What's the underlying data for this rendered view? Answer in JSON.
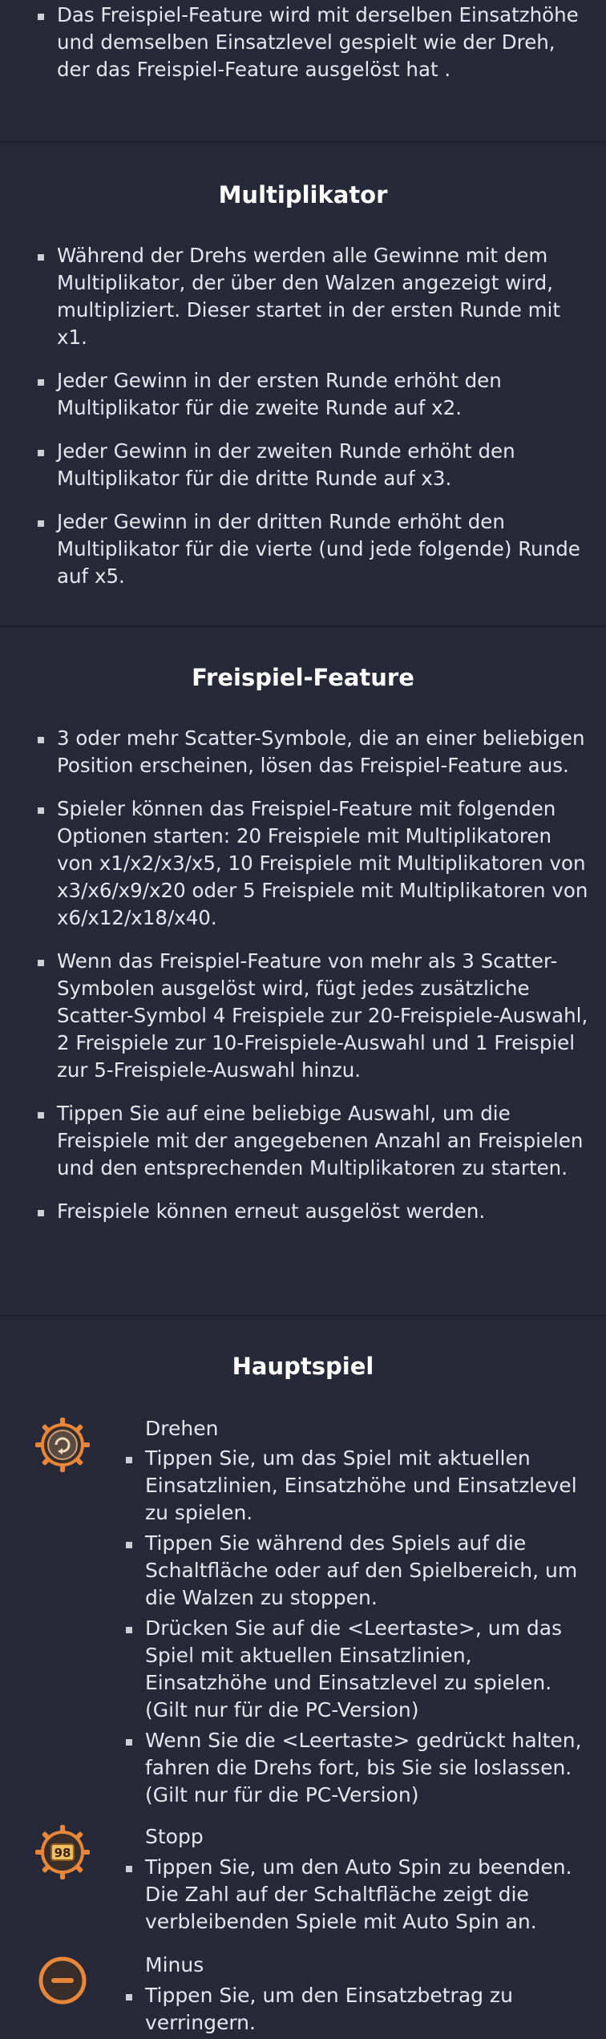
{
  "top_section": {
    "items": [
      "Das Freispiel-Feature wird mit derselben Einsatzhöhe und demselben Einsatzlevel gespielt wie der Dreh, der das Freispiel-Feature ausgelöst hat ."
    ]
  },
  "multiplikator": {
    "title": "Multiplikator",
    "items": [
      "Während der Drehs werden alle Gewinne mit dem Multiplikator, der über den Walzen angezeigt wird, multipliziert. Dieser startet in der ersten Runde mit x1.",
      "Jeder Gewinn in der ersten Runde erhöht den Multiplikator für die zweite Runde auf x2.",
      "Jeder Gewinn in der zweiten Runde erhöht den Multiplikator für die dritte Runde auf x3.",
      "Jeder Gewinn in der dritten Runde erhöht den Multiplikator für die vierte (und jede folgende) Runde auf x5."
    ]
  },
  "freispiel": {
    "title": "Freispiel-Feature",
    "items": [
      "3 oder mehr Scatter-Symbole, die an einer beliebigen Position erscheinen, lösen das Freispiel-Feature aus.",
      "Spieler können das Freispiel-Feature mit folgenden Optionen starten: 20 Freispiele mit Multiplikatoren von x1/x2/x3/x5, 10 Freispiele mit Multiplikatoren von x3/x6/x9/x20 oder 5 Freispiele mit Multiplikatoren von x6/x12/x18/x40.",
      "Wenn das Freispiel-Feature von mehr als 3 Scatter-Symbolen ausgelöst wird, fügt jedes zusätzliche Scatter-Symbol 4 Freispiele zur 20-Freispiele-Auswahl, 2 Freispiele zur 10-Freispiele-Auswahl und 1 Freispiel zur 5-Freispiele-Auswahl hinzu.",
      "Tippen Sie auf eine beliebige Auswahl, um die Freispiele mit der angegebenen Anzahl an Freispielen und den entsprechenden Multiplikatoren zu starten.",
      "Freispiele können erneut ausgelöst werden."
    ]
  },
  "hauptspiel": {
    "title": "Hauptspiel",
    "entries": [
      {
        "icon": "spin-icon",
        "title": "Drehen",
        "items": [
          "Tippen Sie, um das Spiel mit aktuellen Einsatzlinien, Einsatzhöhe und Einsatzlevel zu spielen.",
          "Tippen Sie während des Spiels auf die Schaltfläche oder auf den Spielbereich, um die Walzen zu stoppen.",
          "Drücken Sie auf die <Leertaste>, um das Spiel mit aktuellen Einsatzlinien, Einsatzhöhe und Einsatzlevel zu spielen. (Gilt nur für die PC-Version)",
          "Wenn Sie die <Leertaste> gedrückt halten, fahren die Drehs fort, bis Sie sie loslassen. (Gilt nur für die PC-Version)"
        ]
      },
      {
        "icon": "stop-autospin-icon",
        "icon_text": "98",
        "title": "Stopp",
        "items": [
          "Tippen Sie, um den Auto Spin zu beenden. Die Zahl auf der Schaltfläche zeigt die verbleibenden Spiele mit Auto Spin an."
        ]
      },
      {
        "icon": "minus-icon",
        "title": "Minus",
        "items": [
          "Tippen Sie, um den Einsatzbetrag zu verringern."
        ]
      }
    ]
  },
  "colors": {
    "background": "#272838",
    "divider": "#20212e",
    "accent_orange": "#e8873a",
    "icon_dark": "#3a2e2a"
  }
}
